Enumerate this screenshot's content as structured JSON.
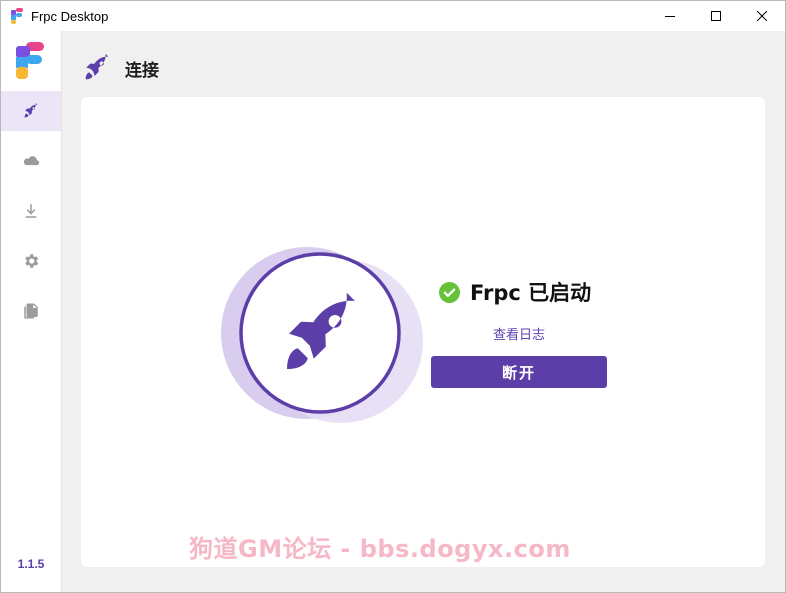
{
  "window": {
    "title": "Frpc Desktop"
  },
  "sidebar": {
    "items": [
      {
        "icon": "rocket-icon",
        "active": true
      },
      {
        "icon": "cloud-icon",
        "active": false
      },
      {
        "icon": "download-icon",
        "active": false
      },
      {
        "icon": "gear-icon",
        "active": false
      },
      {
        "icon": "file-copy-icon",
        "active": false
      }
    ],
    "version": "1.1.5"
  },
  "header": {
    "title": "连接",
    "icon": "rocket-icon"
  },
  "status": {
    "text": "Frpc 已启动",
    "icon": "check-circle-icon",
    "log_link": "查看日志",
    "disconnect_label": "断开"
  },
  "watermark": {
    "text": "狗道GM论坛 - bbs.dogyx.com"
  },
  "colors": {
    "accent": "#5c3ea8",
    "success": "#67c23a",
    "active_bg": "#ebe5f7",
    "watermark": "#f6b7c7"
  }
}
